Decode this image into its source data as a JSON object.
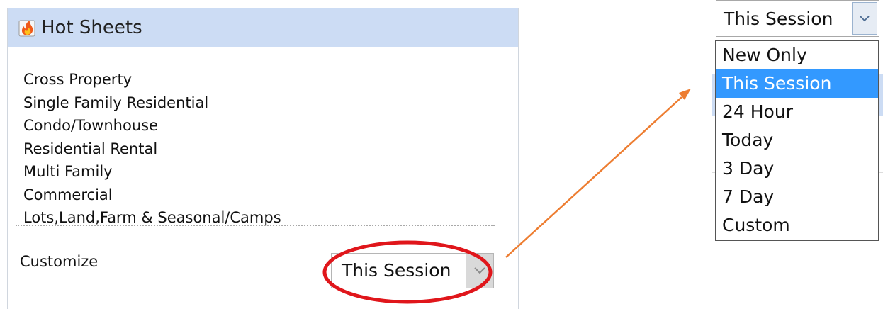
{
  "panel": {
    "title": "Hot Sheets",
    "icon": "fire-icon",
    "links": [
      "Cross Property",
      "Single Family Residential",
      "Condo/Townhouse",
      "Residential Rental",
      "Multi Family",
      "Commercial",
      "Lots,Land,Farm & Seasonal/Camps"
    ],
    "customize_label": "Customize",
    "select_value": "This Session"
  },
  "dropdown": {
    "selected_value": "This Session",
    "options": [
      {
        "label": "New Only",
        "selected": false
      },
      {
        "label": "This Session",
        "selected": true
      },
      {
        "label": "24 Hour",
        "selected": false
      },
      {
        "label": "Today",
        "selected": false
      },
      {
        "label": "3 Day",
        "selected": false
      },
      {
        "label": "7 Day",
        "selected": false
      },
      {
        "label": "Custom",
        "selected": false
      }
    ]
  },
  "colors": {
    "header_bg": "#ccdcf4",
    "annotation_ellipse": "#e0161b",
    "annotation_arrow": "#ed7d31",
    "option_selected_bg": "#3399ff"
  }
}
